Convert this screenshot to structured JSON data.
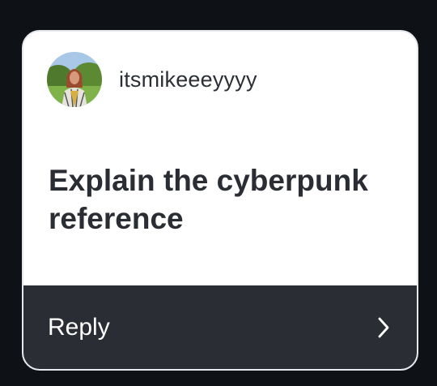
{
  "post": {
    "username": "itsmikeeeyyyy",
    "question": "Explain the cyberpunk reference"
  },
  "actions": {
    "reply_label": "Reply"
  },
  "icons": {
    "avatar": "user-avatar-photo",
    "chevron": "chevron-right-icon"
  },
  "colors": {
    "background": "#0e1116",
    "card": "#ffffff",
    "reply_bar": "#2a2d33",
    "text": "#2a2d33"
  }
}
